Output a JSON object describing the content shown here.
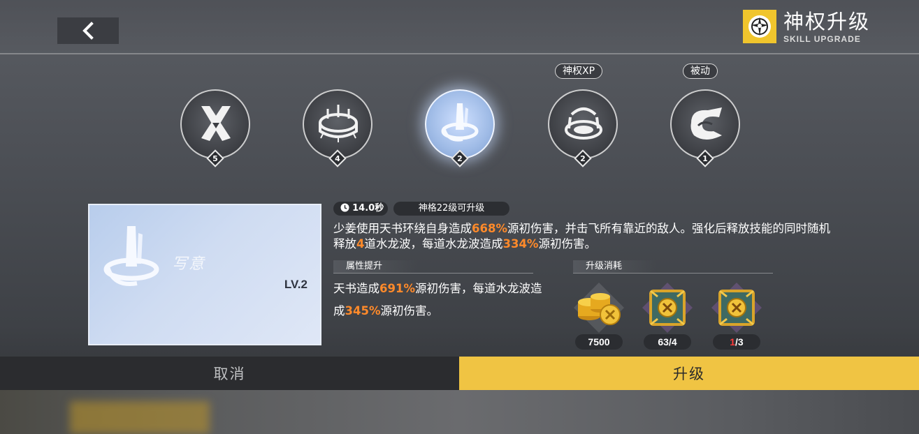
{
  "header": {
    "title_cn": "神权升级",
    "title_en": "SKILL UPGRADE",
    "back_icon": "chevron-left-icon"
  },
  "skills": [
    {
      "icon": "crossed-blades-icon",
      "level": "5",
      "tag": "",
      "active": false
    },
    {
      "icon": "ring-altar-icon",
      "level": "4",
      "tag": "",
      "active": false
    },
    {
      "icon": "water-pillar-icon",
      "level": "2",
      "tag": "",
      "active": true
    },
    {
      "icon": "throne-icon",
      "level": "2",
      "tag": "神权XP",
      "active": false
    },
    {
      "icon": "scroll-wave-icon",
      "level": "1",
      "tag": "被动",
      "active": false
    }
  ],
  "card": {
    "name": "写意",
    "level": "LV.2"
  },
  "info": {
    "cooldown": "14.0秒",
    "requirement": "神格22级可升级",
    "desc_parts": [
      "少姜使用天书环绕自身造成",
      "668%",
      "源初伤害，并击飞所有靠近的敌人。强化后释放技能的同时随机释放",
      "4",
      "道水龙波，每道水龙波造成",
      "334%",
      "源初伤害。"
    ]
  },
  "attr": {
    "label": "属性提升",
    "parts": [
      "天书造成",
      "691%",
      "源初伤害，每道水龙波造成",
      "345%",
      "源初伤害。"
    ]
  },
  "cost": {
    "label": "升级消耗",
    "items": [
      {
        "icon": "gold-coins-icon",
        "owned": "7500",
        "need": ""
      },
      {
        "icon": "skill-book-icon",
        "owned": "63",
        "need": "/4"
      },
      {
        "icon": "skill-book-icon",
        "owned": "1",
        "need": "/3"
      }
    ]
  },
  "buttons": {
    "cancel": "取消",
    "upgrade": "升级"
  },
  "colors": {
    "accent": "#f0c443",
    "highlight": "#ff8a2a",
    "insufficient": "#ff3b3b"
  }
}
